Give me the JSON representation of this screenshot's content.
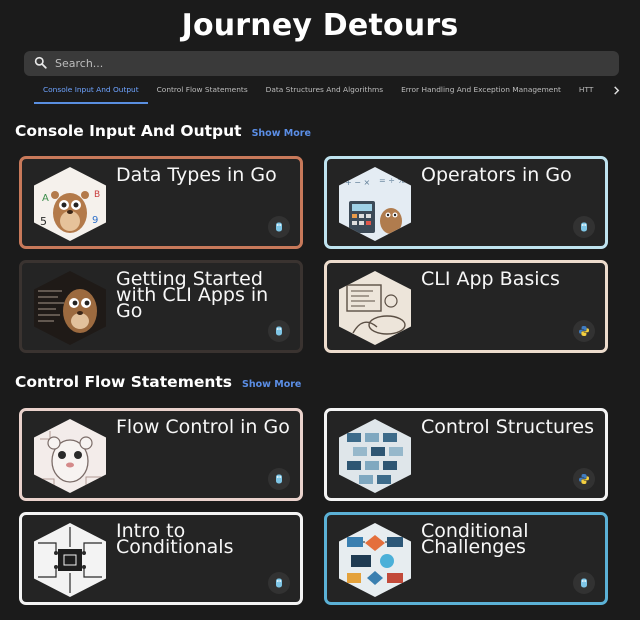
{
  "header": {
    "title": "Journey Detours"
  },
  "search": {
    "placeholder": "Search..."
  },
  "tabs": [
    {
      "label": "Console Input And Output",
      "active": true
    },
    {
      "label": "Control Flow Statements",
      "active": false
    },
    {
      "label": "Data Structures And Algorithms",
      "active": false
    },
    {
      "label": "Error Handling And Exception Management",
      "active": false
    },
    {
      "label": "HTT",
      "active": false
    }
  ],
  "sections": [
    {
      "title": "Console Input And Output",
      "show_more": "Show More",
      "cards": [
        {
          "title": "Data Types in Go",
          "image": "gopher-numbers-image",
          "language_icon": "go-gopher-icon",
          "border_color": "#c8795a"
        },
        {
          "title": "Operators in Go",
          "image": "gopher-calculator-image",
          "language_icon": "go-gopher-icon",
          "border_color": "#bfe3ef"
        },
        {
          "title": "Getting Started with CLI Apps in Go",
          "image": "gopher-terminal-image",
          "language_icon": "go-gopher-icon",
          "border_color": "#3a3330"
        },
        {
          "title": "CLI App Basics",
          "image": "sketch-terminal-image",
          "language_icon": "python-icon",
          "border_color": "#eddccd"
        }
      ]
    },
    {
      "title": "Control Flow Statements",
      "show_more": "Show More",
      "cards": [
        {
          "title": "Flow Control in Go",
          "image": "gopher-circuit-image",
          "language_icon": "go-gopher-icon",
          "border_color": "#ead2cc"
        },
        {
          "title": "Control Structures",
          "image": "isometric-blocks-image",
          "language_icon": "python-icon",
          "border_color": "#f4f4f4"
        },
        {
          "title": "Intro to Conditionals",
          "image": "circuit-chip-image",
          "language_icon": "go-gopher-icon",
          "border_color": "#f4f4f4"
        },
        {
          "title": "Conditional Challenges",
          "image": "flowchart-collage-image",
          "language_icon": "go-gopher-icon",
          "border_color": "#5bb1d6"
        }
      ]
    }
  ]
}
